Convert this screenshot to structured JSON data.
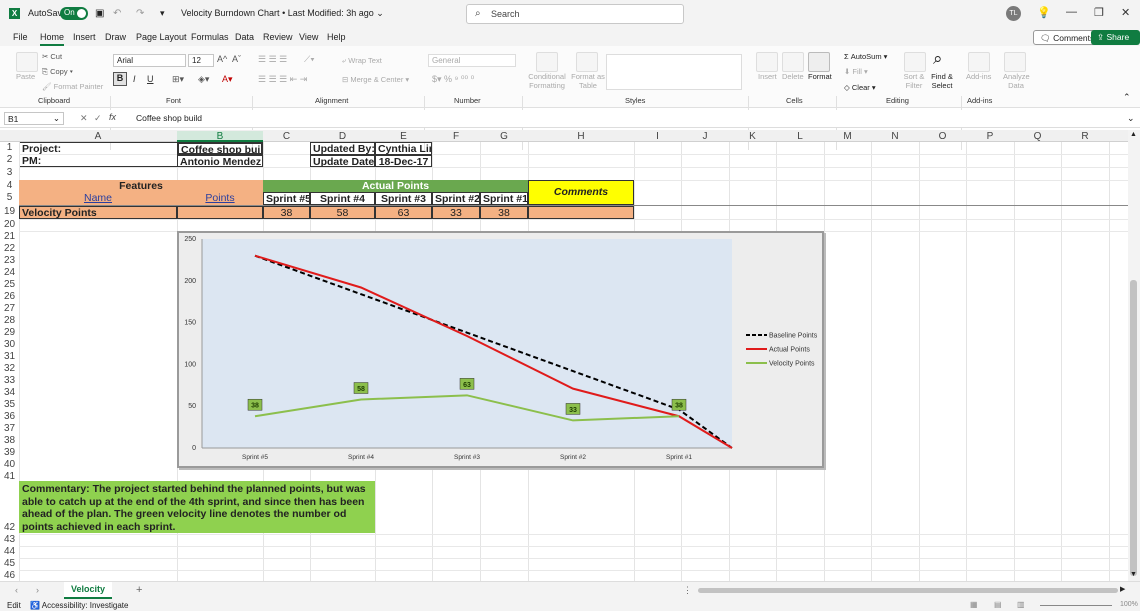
{
  "titlebar": {
    "autosave_label": "AutoSave",
    "autosave_state": "On",
    "file_title": "Velocity Burndown Chart",
    "modified": "Last Modified: 3h ago",
    "search_placeholder": "Search",
    "user_initials": "TL"
  },
  "menu": {
    "tabs": [
      "File",
      "Home",
      "Insert",
      "Draw",
      "Page Layout",
      "Formulas",
      "Data",
      "Review",
      "View",
      "Help"
    ],
    "active_tab": "Home",
    "comments_label": "Comments",
    "share_label": "Share"
  },
  "ribbon": {
    "clipboard": {
      "paste": "Paste",
      "cut": "Cut",
      "copy": "Copy",
      "format_painter": "Format Painter",
      "group": "Clipboard"
    },
    "font": {
      "name": "Arial",
      "size": "12",
      "bold": "B",
      "italic": "I",
      "underline": "U",
      "group": "Font"
    },
    "alignment": {
      "wrap": "Wrap Text",
      "merge": "Merge & Center",
      "group": "Alignment"
    },
    "number": {
      "format": "General",
      "group": "Number"
    },
    "styles": {
      "conditional": "Conditional Formatting",
      "format_table": "Format as Table",
      "group": "Styles"
    },
    "cells": {
      "insert": "Insert",
      "delete": "Delete",
      "format": "Format",
      "group": "Cells"
    },
    "editing": {
      "autosum": "AutoSum",
      "fill": "Fill",
      "clear": "Clear",
      "sort": "Sort & Filter",
      "find": "Find & Select",
      "group": "Editing"
    },
    "addins": {
      "addins": "Add-ins",
      "analyze": "Analyze Data",
      "group": "Add-ins"
    }
  },
  "formula_bar": {
    "cell_ref": "B1",
    "fx": "fx",
    "content": "Coffee shop build"
  },
  "columns": [
    "A",
    "B",
    "C",
    "D",
    "E",
    "F",
    "G",
    "H",
    "I",
    "J",
    "K",
    "L",
    "M",
    "N",
    "O",
    "P",
    "Q",
    "R"
  ],
  "rows": [
    "1",
    "2",
    "3",
    "4",
    "5",
    "19",
    "20",
    "21",
    "22",
    "23",
    "24",
    "25",
    "26",
    "27",
    "28",
    "29",
    "30",
    "31",
    "32",
    "33",
    "34",
    "35",
    "36",
    "37",
    "38",
    "39",
    "40",
    "41",
    "42",
    "43",
    "44",
    "45",
    "46"
  ],
  "sheet": {
    "project_label": "Project:",
    "project_value": "Coffee shop build",
    "pm_label": "PM:",
    "pm_value": "Antonio Mendez",
    "updated_by_label": "Updated By:",
    "updated_by_value": "Cynthia Lin",
    "update_date_label": "Update Date:",
    "update_date_value": "18-Dec-17",
    "features_header": "Features",
    "actual_points_header": "Actual Points",
    "comments_header": "Comments",
    "name_header": "Name",
    "points_header": "Points",
    "sprints": [
      "Sprint #5",
      "Sprint #4",
      "Sprint #3",
      "Sprint #2",
      "Sprint #1"
    ],
    "velocity_label": "Velocity Points",
    "velocity_values": [
      "38",
      "58",
      "63",
      "33",
      "38"
    ],
    "commentary": "Commentary: The project started behind the planned points, but was able to catch up at the end of the 4th sprint, and since then has been ahead of the plan. The green velocity line denotes the number od points achieved in each sprint."
  },
  "chart_data": {
    "type": "line",
    "categories": [
      "Sprint #5",
      "Sprint #4",
      "Sprint #3",
      "Sprint #2",
      "Sprint #1"
    ],
    "ylim": [
      0,
      250
    ],
    "yticks": [
      "0",
      "50",
      "100",
      "150",
      "200",
      "250"
    ],
    "series": [
      {
        "name": "Baseline Points",
        "color": "#000000",
        "dash": true,
        "x": [
          0.5,
          1.5,
          2.5,
          3.5,
          4.5,
          5.0
        ],
        "values": [
          230,
          184,
          138,
          92,
          46,
          0
        ]
      },
      {
        "name": "Actual Points",
        "color": "#e01b1b",
        "dash": false,
        "x": [
          0.5,
          1.5,
          2.5,
          3.5,
          4.5,
          5.0
        ],
        "values": [
          230,
          192,
          134,
          71,
          38,
          0
        ]
      },
      {
        "name": "Velocity Points",
        "color": "#8cbf4c",
        "dash": false,
        "x": [
          0.5,
          1.5,
          2.5,
          3.5,
          4.5
        ],
        "values": [
          38,
          58,
          63,
          33,
          38
        ],
        "labels": [
          "38",
          "58",
          "63",
          "33",
          "38"
        ]
      }
    ],
    "grid": false,
    "legend": "right",
    "plot_background": "#dce6f2"
  },
  "sheet_tabs": {
    "active": "Velocity"
  },
  "status": {
    "mode": "Edit",
    "accessibility": "Accessibility: Investigate",
    "zoom": "100%"
  },
  "colors": {
    "excel_green": "#107c41",
    "header_green": "#6aa84f",
    "salmon": "#f4b183",
    "yellow": "#ffff00",
    "commentary_green": "#8fd14f"
  }
}
